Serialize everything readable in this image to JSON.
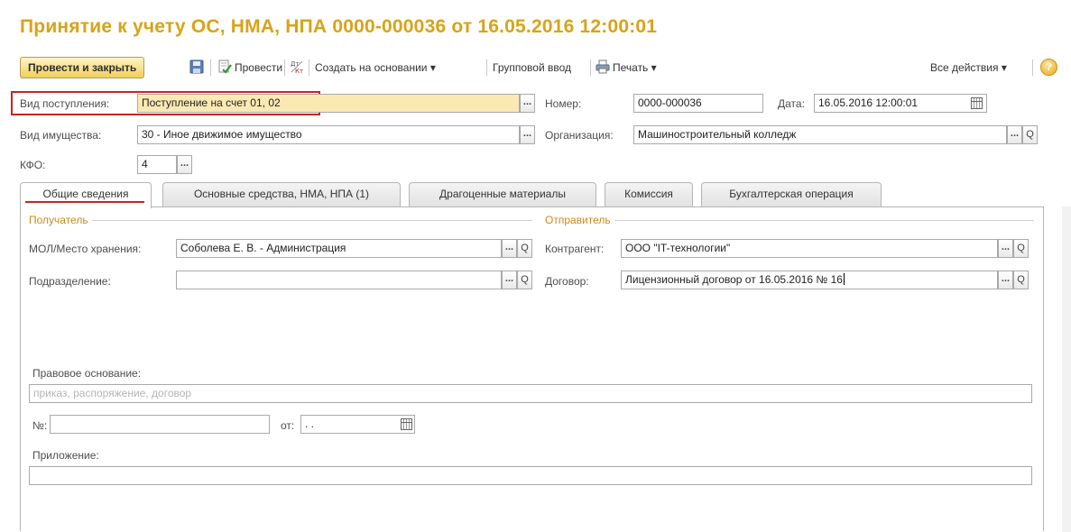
{
  "window": {
    "title": "Принятие к учету ОС, НМА, НПА 0000-000036 от 16.05.2016 12:00:01"
  },
  "toolbar": {
    "post_and_close": "Провести и закрыть",
    "post": "Провести",
    "create_based_on": "Создать на основании",
    "group_input": "Групповой ввод",
    "print": "Печать",
    "all_actions": "Все действия",
    "help": "?"
  },
  "header": {
    "receipt_type": {
      "label": "Вид поступления:",
      "value": "Поступление на счет 01, 02"
    },
    "number": {
      "label": "Номер:",
      "value": "0000-000036"
    },
    "date": {
      "label": "Дата:",
      "value": "16.05.2016 12:00:01"
    },
    "property_type": {
      "label": "Вид имущества:",
      "value": "30 - Иное движимое имущество"
    },
    "organization": {
      "label": "Организация:",
      "value": "Машиностроительный колледж"
    },
    "kfo": {
      "label": "КФО:",
      "value": "4"
    }
  },
  "tabs": [
    {
      "label": "Общие сведения",
      "active": true
    },
    {
      "label": "Основные средства, НМА, НПА (1)",
      "active": false
    },
    {
      "label": "Драгоценные материалы",
      "active": false
    },
    {
      "label": "Комиссия",
      "active": false
    },
    {
      "label": "Бухгалтерская операция",
      "active": false
    }
  ],
  "general": {
    "recipient": {
      "title": "Получатель",
      "mol": {
        "label": "МОЛ/Место хранения:",
        "value": "Соболева Е. В. - Администрация"
      },
      "department": {
        "label": "Подразделение:",
        "value": ""
      }
    },
    "sender": {
      "title": "Отправитель",
      "counterparty": {
        "label": "Контрагент:",
        "value": "ООО \"IT-технологии\""
      },
      "contract": {
        "label": "Договор:",
        "value": "Лицензионный договор от 16.05.2016 № 16"
      }
    },
    "legal_basis": {
      "label": "Правовое основание:",
      "placeholder": "приказ, распоряжение, договор"
    },
    "doc_number": {
      "label": "№:",
      "value": ""
    },
    "doc_date": {
      "label": "от:",
      "value": " .  ."
    },
    "attachment": {
      "label": "Приложение:",
      "value": ""
    }
  },
  "icons": {
    "choice": "...",
    "search": "Q",
    "dropdown": "▾"
  }
}
